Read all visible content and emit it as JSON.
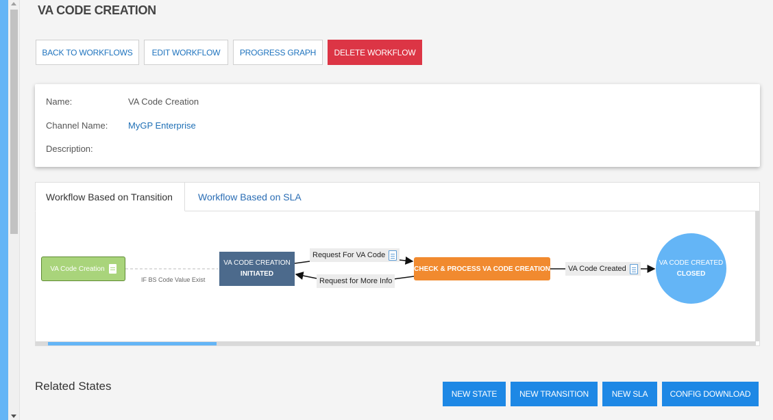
{
  "page": {
    "title": "VA CODE CREATION"
  },
  "toolbar": {
    "back": "BACK TO WORKFLOWS",
    "edit": "EDIT WORKFLOW",
    "progress": "PROGRESS GRAPH",
    "delete": "DELETE WORKFLOW"
  },
  "info": {
    "name_label": "Name:",
    "name_value": "VA Code Creation",
    "channel_label": "Channel Name:",
    "channel_value": "MyGP Enterprise",
    "description_label": "Description:",
    "description_value": ""
  },
  "tabs": [
    {
      "label": "Workflow Based on Transition",
      "active": true
    },
    {
      "label": "Workflow Based on SLA",
      "active": false
    }
  ],
  "diagram": {
    "start_node": "VA Code Creation",
    "start_condition": "IF BS Code Value Exist",
    "initiated_node": {
      "line1": "VA CODE CREATION",
      "line2": "INITIATED"
    },
    "check_node": "CHECK & PROCESS VA CODE CREATION",
    "closed_node": {
      "line1": "VA CODE CREATED",
      "line2": "CLOSED"
    },
    "edge_request": "Request For VA Code",
    "edge_more_info": "Request for More Info",
    "edge_created": "VA Code Created",
    "colors": {
      "start": "#a9d47b",
      "initiated": "#4c6a8c",
      "check": "#f18a2f",
      "closed": "#64b5f6"
    }
  },
  "related": {
    "title": "Related States",
    "new_state": "NEW STATE",
    "new_transition": "NEW TRANSITION",
    "new_sla": "NEW SLA",
    "config_download": "CONFIG DOWNLOAD"
  },
  "colors": {
    "accent": "#1e88e5",
    "danger": "#dc3545",
    "link": "#1e73be"
  }
}
